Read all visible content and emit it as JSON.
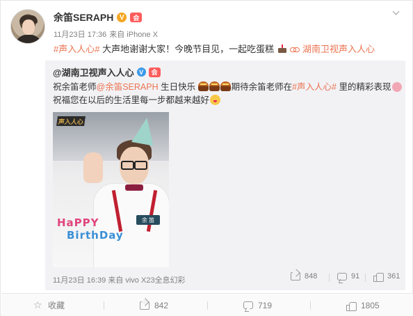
{
  "post": {
    "username": "余笛SERAPH",
    "verified_badge": "V",
    "member_badge": "会",
    "timestamp": "11月23日 17:36",
    "source": "来自 iPhone X",
    "text": {
      "hashtag": "#声入人心#",
      "body": " 大声地谢谢大家！今晚节目见，一起吃蛋糕",
      "link_label": "湖南卫视声入人心"
    }
  },
  "repost": {
    "username": "@湖南卫视声入人心",
    "verified_badge": "V",
    "line1_prefix": "祝余笛老师",
    "line1_mention": "@余笛SERAPH",
    "line1_mid": " 生日快乐",
    "line1_after": "期待余笛老师在",
    "line1_hashtag": "#声入人心#",
    "line1_suffix": " 里的精彩表现",
    "line2": "祝福您在以后的生活里每一步都越来越好",
    "image": {
      "logo_text": "声入人心",
      "nametag": "余 笛",
      "overlay_line1": "HaPPY",
      "overlay_line2": "BirthDay"
    },
    "footer": {
      "timestamp": "11月23日 16:39",
      "source": "来自 vivo X23全息幻彩",
      "share_count": "848",
      "comment_count": "91",
      "like_count": "361"
    }
  },
  "actions": {
    "favorite_label": "收藏",
    "share_count": "842",
    "comment_count": "719",
    "like_count": "1805"
  }
}
